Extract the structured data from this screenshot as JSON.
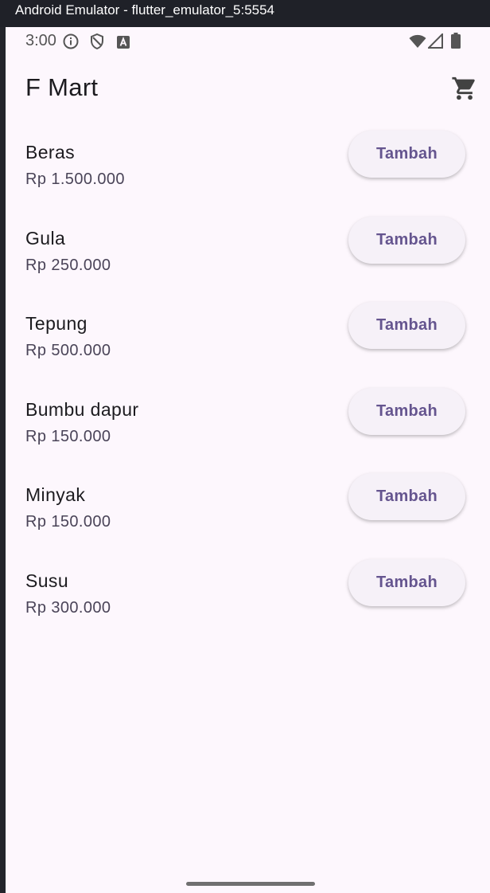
{
  "window": {
    "title": "Android Emulator - flutter_emulator_5:5554"
  },
  "status_bar": {
    "time": "3:00",
    "left_icons": [
      "info-icon",
      "shield-icon",
      "a-badge-icon"
    ],
    "right_icons": [
      "wifi-icon",
      "cell-signal-icon",
      "battery-icon"
    ]
  },
  "app_bar": {
    "title": "F Mart",
    "action_icon": "cart-icon"
  },
  "products": [
    {
      "name": "Beras",
      "price": "Rp 1.500.000",
      "button": "Tambah"
    },
    {
      "name": "Gula",
      "price": "Rp 250.000",
      "button": "Tambah"
    },
    {
      "name": "Tepung",
      "price": "Rp 500.000",
      "button": "Tambah"
    },
    {
      "name": "Bumbu dapur",
      "price": "Rp 150.000",
      "button": "Tambah"
    },
    {
      "name": "Minyak",
      "price": "Rp 150.000",
      "button": "Tambah"
    },
    {
      "name": "Susu",
      "price": "Rp 300.000",
      "button": "Tambah"
    }
  ],
  "colors": {
    "background": "#fdf7fd",
    "button_bg": "#f6f1f8",
    "button_text": "#65558f",
    "title_bar": "#1f2128"
  }
}
